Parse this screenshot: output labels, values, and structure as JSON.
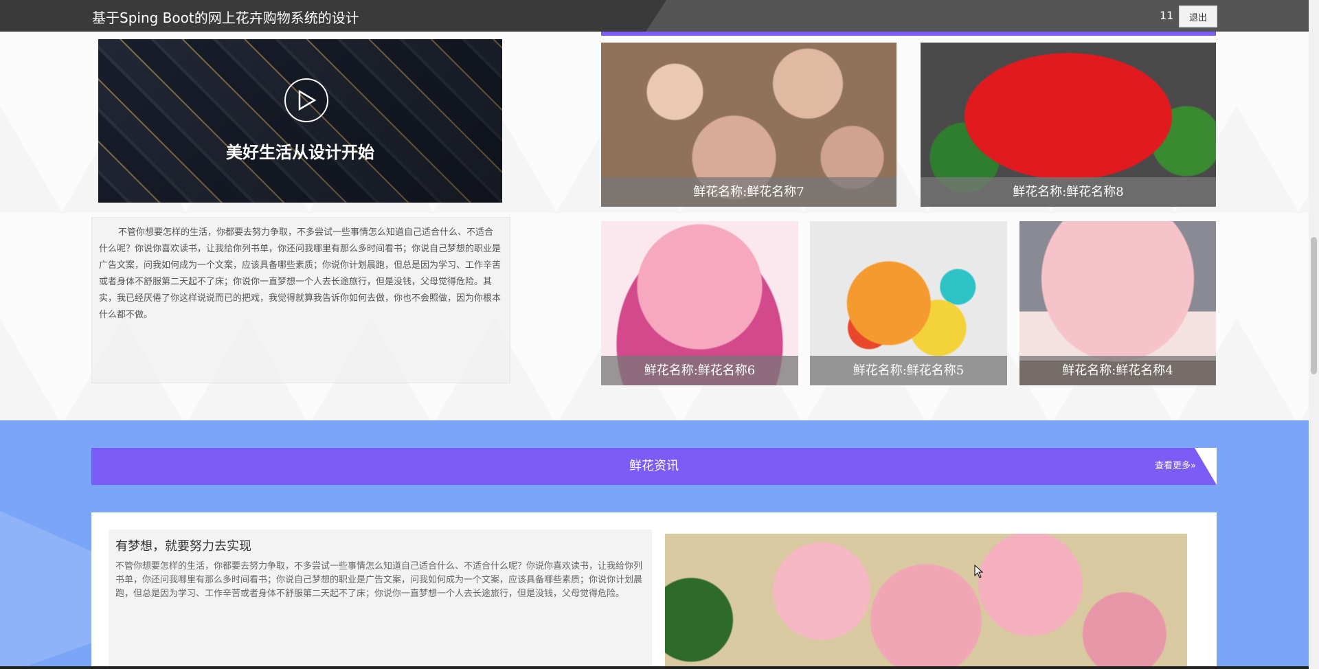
{
  "header": {
    "title": "基于Sping Boot的网上花卉购物系统的设计",
    "user_id": "11",
    "logout_label": "退出"
  },
  "video": {
    "caption": "美好生活从设计开始"
  },
  "intro": {
    "text": "不管你想要怎样的生活，你都要去努力争取，不多尝试一些事情怎么知道自己适合什么、不适合什么呢？你说你喜欢读书，让我给你列书单，你还问我哪里有那么多时间看书；你说自己梦想的职业是广告文案，问我如何成为一个文案，应该具备哪些素质；你说你计划晨跑，但总是因为学习、工作辛苦或者身体不舒服第二天起不了床；你说你一直梦想一个人去长途旅行，但是没钱，父母觉得危险。其实，我已经厌倦了你这样说说而已的把戏，我觉得就算我告诉你如何去做，你也不会照做，因为你根本什么都不做。"
  },
  "flowers": [
    {
      "name": "鲜花名称:鲜花名称7"
    },
    {
      "name": "鲜花名称:鲜花名称8"
    },
    {
      "name": "鲜花名称:鲜花名称6"
    },
    {
      "name": "鲜花名称:鲜花名称5"
    },
    {
      "name": "鲜花名称:鲜花名称4"
    }
  ],
  "news": {
    "section_title": "鲜花资讯",
    "view_more": "查看更多»",
    "headline": "有梦想，就要努力去实现",
    "summary": "不管你想要怎样的生活，你都要去努力争取，不多尝试一些事情怎么知道自己适合什么、不适合什么呢？你说你喜欢读书，让我给你列书单，你还问我哪里有那么多时间看书；你说自己梦想的职业是广告文案，问我如何成为一个文案，应该具备哪些素质；你说你计划晨跑，但总是因为学习、工作辛苦或者身体不舒服第二天起不了床；你说你一直梦想一个人去长途旅行，但是没钱，父母觉得危险。"
  },
  "colors": {
    "accent": "#7b5cf6",
    "news_bg": "#7ba6f8",
    "topbar": "#3a3a3a"
  },
  "icons": {
    "video": "play-icon",
    "cursor": "mouse-cursor-icon"
  }
}
